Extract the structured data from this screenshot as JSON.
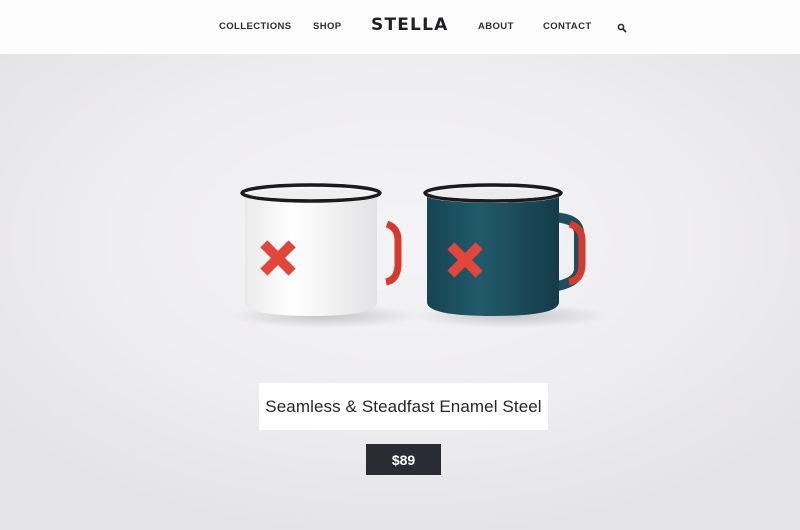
{
  "nav": {
    "collections": "COLLECTIONS",
    "shop": "SHOP",
    "brand": "STELLA",
    "about": "ABOUT",
    "contact": "CONTACT",
    "search_icon": "search-icon"
  },
  "product": {
    "title": "Seamless & Steadfast Enamel Steel",
    "price": "$89"
  },
  "colors": {
    "nav_text": "#2c2d33",
    "price_bg": "#2a2c33",
    "mug_white": "#f7f7f7",
    "mug_teal": "#1e4f5e",
    "accent_red": "#e2463a"
  }
}
